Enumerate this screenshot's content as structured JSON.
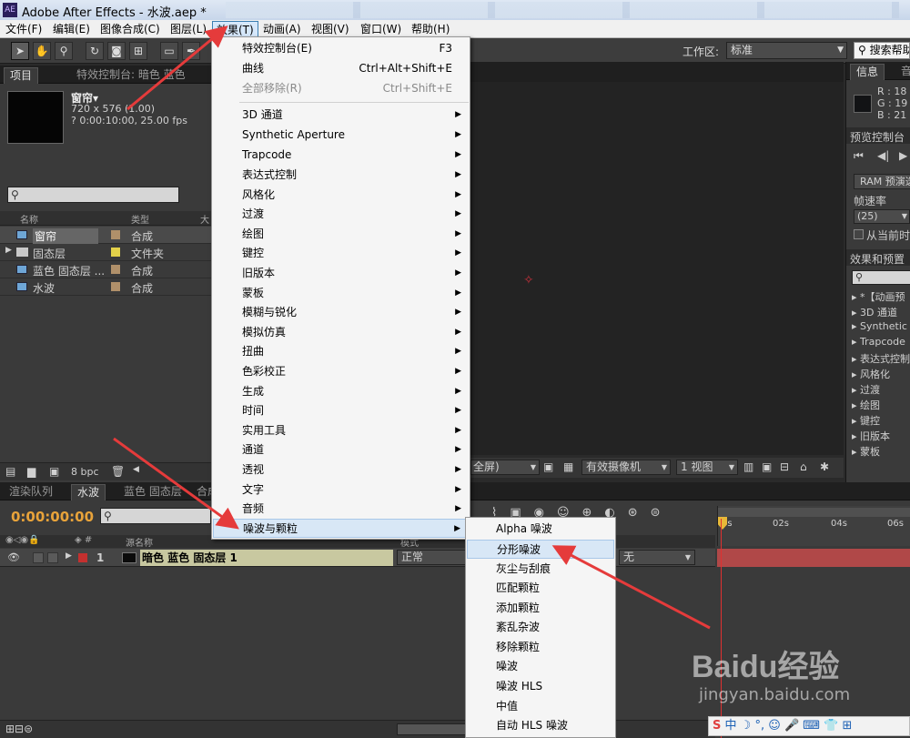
{
  "window": {
    "title": "Adobe After Effects - 水波.aep *",
    "app_badge": "AE"
  },
  "menubar": [
    "文件(F)",
    "编辑(E)",
    "图像合成(C)",
    "图层(L)",
    "效果(T)",
    "动画(A)",
    "视图(V)",
    "窗口(W)",
    "帮助(H)"
  ],
  "toolbar": {
    "workspace_label": "工作区:",
    "workspace_value": "标准",
    "search_help": "搜索帮助"
  },
  "project_panel": {
    "tab_project": "项目",
    "tab_effects_control": "特效控制台: 暗色 蓝色",
    "comp_name": "窗帘▾",
    "comp_res": "720 x 576 (1.00)",
    "comp_dur": "? 0:00:10:00, 25.00 fps",
    "col_name": "名称",
    "col_type": "类型",
    "col_size": "大",
    "rows": [
      {
        "name": "窗帘",
        "type": "合成"
      },
      {
        "name": "固态层",
        "type": "文件夹"
      },
      {
        "name": "蓝色 固态层 ...",
        "type": "合成"
      },
      {
        "name": "水波",
        "type": "合成"
      }
    ],
    "bpc": "8 bpc"
  },
  "viewer": {
    "fullscreen": "全屏)",
    "camera": "有效摄像机",
    "views": "1 视图"
  },
  "right_panel": {
    "info_tab": "信息",
    "audio_tab": "音",
    "r": "R : 18",
    "g": "G : 19",
    "b": "B : 21",
    "preview_title": "预览控制台",
    "ram_preview": "RAM 预演选",
    "framerate_label": "帧速率",
    "framerate_value": "(25)",
    "from_current": "从当前时",
    "effects_title": "效果和预置",
    "effects": [
      "*【动画预",
      "3D 通道",
      "Synthetic A",
      "Trapcode",
      "表达式控制",
      "风格化",
      "过渡",
      "绘图",
      "键控",
      "旧版本",
      "蒙板"
    ]
  },
  "timeline": {
    "tabs": [
      "渲染队列",
      "水波",
      "蓝色 固态层",
      "合成"
    ],
    "timecode": "0:00:00:00",
    "col_source": "源名称",
    "col_mode": "模式",
    "layer_num": "1",
    "layer_name": "暗色 蓝色 固态层 1",
    "layer_mode": "正常",
    "parent_value": "无",
    "ruler": [
      "0s",
      "02s",
      "04s",
      "06s"
    ]
  },
  "effects_menu": {
    "items": [
      {
        "label": "特效控制台(E)",
        "shortcut": "F3"
      },
      {
        "label": "曲线",
        "shortcut": "Ctrl+Alt+Shift+E"
      },
      {
        "label": "全部移除(R)",
        "shortcut": "Ctrl+Shift+E"
      },
      {
        "label": "3D 通道"
      },
      {
        "label": "Synthetic Aperture"
      },
      {
        "label": "Trapcode"
      },
      {
        "label": "表达式控制"
      },
      {
        "label": "风格化"
      },
      {
        "label": "过渡"
      },
      {
        "label": "绘图"
      },
      {
        "label": "键控"
      },
      {
        "label": "旧版本"
      },
      {
        "label": "蒙板"
      },
      {
        "label": "模糊与锐化"
      },
      {
        "label": "模拟仿真"
      },
      {
        "label": "扭曲"
      },
      {
        "label": "色彩校正"
      },
      {
        "label": "生成"
      },
      {
        "label": "时间"
      },
      {
        "label": "实用工具"
      },
      {
        "label": "通道"
      },
      {
        "label": "透视"
      },
      {
        "label": "文字"
      },
      {
        "label": "音频"
      },
      {
        "label": "噪波与颗粒"
      }
    ]
  },
  "noise_submenu": [
    "Alpha 噪波",
    "分形噪波",
    "灰尘与刮痕",
    "匹配颗粒",
    "添加颗粒",
    "紊乱杂波",
    "移除颗粒",
    "噪波",
    "噪波 HLS",
    "中值",
    "自动 HLS 噪波"
  ],
  "watermark": {
    "brand": "Baidu经验",
    "url": "jingyan.baidu.com"
  },
  "colors": {
    "arrow": "#e53b3b",
    "timecode": "#e8a33a",
    "layer_label": "#c8c8a0"
  }
}
